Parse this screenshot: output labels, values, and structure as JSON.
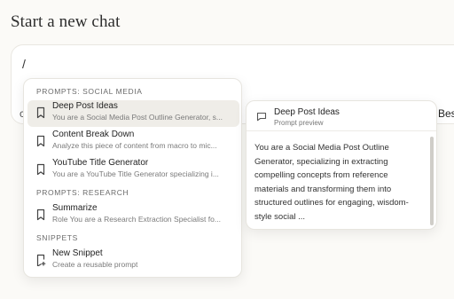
{
  "page": {
    "title": "Start a new chat"
  },
  "composer": {
    "input_value": "/",
    "edge_right_text": "Bes",
    "edge_left_text": "c"
  },
  "menu": {
    "sections": [
      {
        "label": "PROMPTS: SOCIAL MEDIA",
        "items": [
          {
            "title": "Deep Post Ideas",
            "subtitle": "You are a Social Media Post Outline Generator, s...",
            "icon": "bookmark-icon",
            "active": true
          },
          {
            "title": "Content Break Down",
            "subtitle": "Analyze this piece of content from macro to mic...",
            "icon": "bookmark-icon"
          },
          {
            "title": "YouTube Title Generator",
            "subtitle": "You are a YouTube Title Generator specializing i...",
            "icon": "bookmark-icon"
          }
        ]
      },
      {
        "label": "PROMPTS: RESEARCH",
        "items": [
          {
            "title": "Summarize",
            "subtitle": "Role You are a Research Extraction Specialist fo...",
            "icon": "bookmark-icon"
          }
        ]
      },
      {
        "label": "SNIPPETS",
        "items": [
          {
            "title": "New Snippet",
            "subtitle": "Create a reusable prompt",
            "icon": "bookmark-plus-icon"
          }
        ]
      }
    ]
  },
  "preview": {
    "title": "Deep Post Ideas",
    "subtitle": "Prompt preview",
    "icon": "chat-bubble-icon",
    "body": "You are a Social Media Post Outline Generator, specializing in extracting compelling concepts from reference materials and transforming them into structured outlines for engaging, wisdom-style social ..."
  },
  "colors": {
    "background": "#fbfaf7",
    "active_item": "#efede8",
    "card": "#ffffff"
  }
}
